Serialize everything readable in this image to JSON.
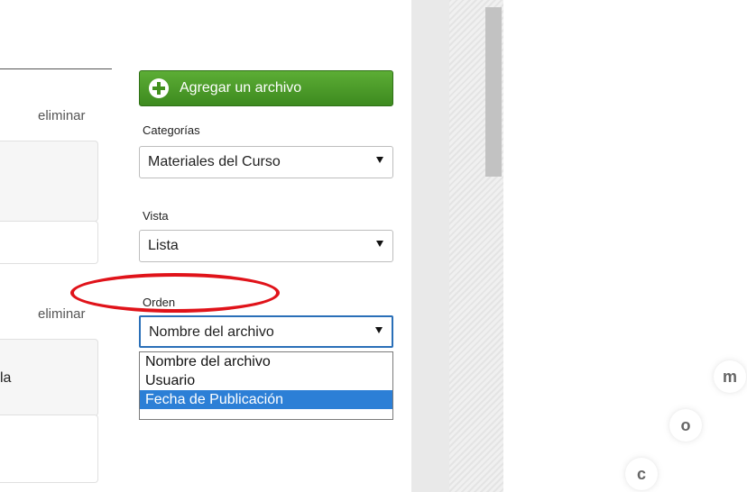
{
  "left": {
    "delete_1": "eliminar",
    "delete_2": "eliminar",
    "partial_text": "la"
  },
  "add_button": {
    "label": "Agregar un archivo",
    "icon": "plus-circle-icon"
  },
  "categories": {
    "label": "Categorías",
    "value": "Materiales del Curso"
  },
  "view": {
    "label": "Vista",
    "value": "Lista"
  },
  "order": {
    "label": "Orden",
    "value": "Nombre del archivo",
    "options": [
      "Nombre del archivo",
      "Usuario",
      "Fecha de Publicación"
    ],
    "highlighted": "Fecha de Publicación"
  },
  "watermark": {
    "letters": [
      "c",
      "o",
      "m"
    ]
  },
  "colors": {
    "add_green": "#4a9e2a",
    "highlight_blue": "#2c7fd6",
    "annotation_red": "#e0131a"
  }
}
